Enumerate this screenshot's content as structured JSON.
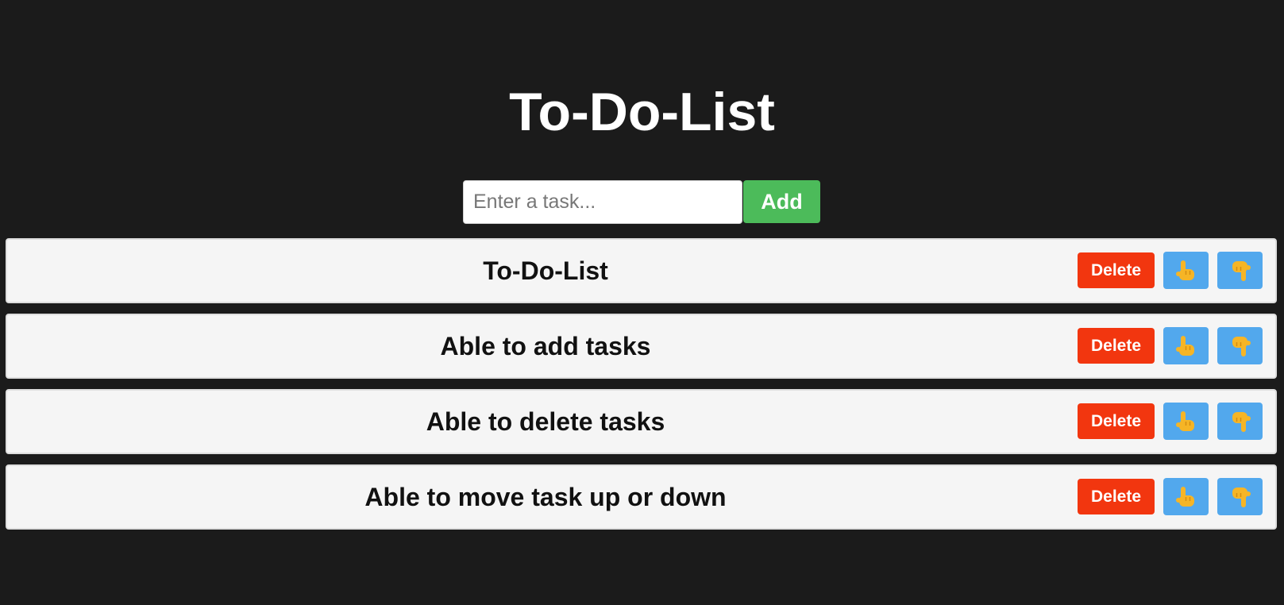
{
  "header": {
    "title": "To-Do-List"
  },
  "add_form": {
    "input_value": "",
    "input_placeholder": "Enter a task...",
    "add_label": "Add"
  },
  "tasks": [
    {
      "text": "To-Do-List",
      "delete_label": "Delete"
    },
    {
      "text": "Able to add tasks",
      "delete_label": "Delete"
    },
    {
      "text": "Able to delete tasks",
      "delete_label": "Delete"
    },
    {
      "text": "Able to move task up or down",
      "delete_label": "Delete"
    }
  ],
  "icons": {
    "move_up": "hand-pointing-up-icon",
    "move_down": "hand-pointing-down-icon"
  },
  "colors": {
    "background": "#1b1b1b",
    "add_button": "#4cbb5a",
    "delete_button": "#f2360f",
    "move_button": "#52a8ed",
    "hand_icon": "#f6b526",
    "task_background": "#f5f5f5"
  }
}
